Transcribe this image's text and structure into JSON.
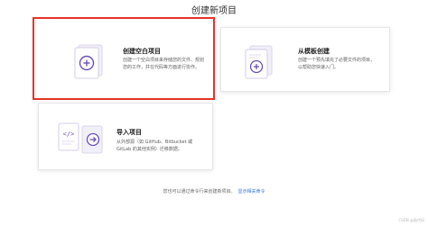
{
  "page": {
    "title": "创建新项目"
  },
  "cards": {
    "blank": {
      "title": "创建空白项目",
      "description": "创建一个空白项目来存储您的文件、规划您的工作，并在代码等方面进行协作。"
    },
    "template": {
      "title": "从模板创建",
      "description": "创建一个预先填充了必要文件的项目，以帮助您快速入门。"
    },
    "import": {
      "title": "导入项目",
      "description": "从外部源（如 GitHub、Bitbucket 或 GitLab 的其他实例）迁移数据。"
    }
  },
  "footer": {
    "note": "您也可以通过命令行来创建新项目。",
    "link": "显示相关命令"
  },
  "watermark": "CSDN @敲代码",
  "colors": {
    "accent": "#6b4fbb",
    "selected_border": "#e5332a",
    "link": "#2f6fd6"
  },
  "icons": [
    "blank-project-illustration",
    "template-illustration",
    "import-illustration",
    "plus-icon",
    "arrow-right-icon",
    "code-icon"
  ]
}
